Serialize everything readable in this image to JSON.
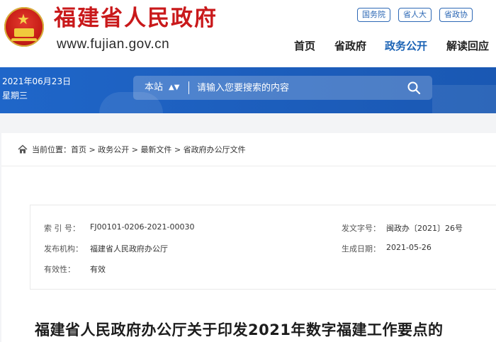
{
  "header": {
    "site_title": "福建省人民政府",
    "site_url": "www.fujian.gov.cn",
    "top_links": [
      "国务院",
      "省人大",
      "省政协"
    ],
    "nav": [
      "首页",
      "省政府",
      "政务公开",
      "解读回应"
    ],
    "active_nav": "政务公开"
  },
  "banner": {
    "date": "2021年06月23日",
    "weekday": "星期三",
    "search_scope": "本站",
    "search_placeholder": "请输入您要搜索的内容"
  },
  "breadcrumb": {
    "prefix": "当前位置：",
    "items": [
      "首页",
      "政务公开",
      "最新文件",
      "省政府办公厅文件"
    ],
    "separator": ">"
  },
  "meta": {
    "index_label": "索 引 号：",
    "index_value": "FJ00101-0206-2021-00030",
    "doc_no_label": "发文字号：",
    "doc_no_value": "闽政办〔2021〕26号",
    "issuer_label": "发布机构：",
    "issuer_value": "福建省人民政府办公厅",
    "date_label": "生成日期：",
    "date_value": "2021-05-26",
    "validity_label": "有效性：",
    "validity_value": "有效"
  },
  "article": {
    "title": "福建省人民政府办公厅关于印发2021年数字福建工作要点的"
  },
  "colors": {
    "brand_red": "#c9191b",
    "brand_blue": "#1d5fbe",
    "nav_active": "#1b63b5"
  }
}
